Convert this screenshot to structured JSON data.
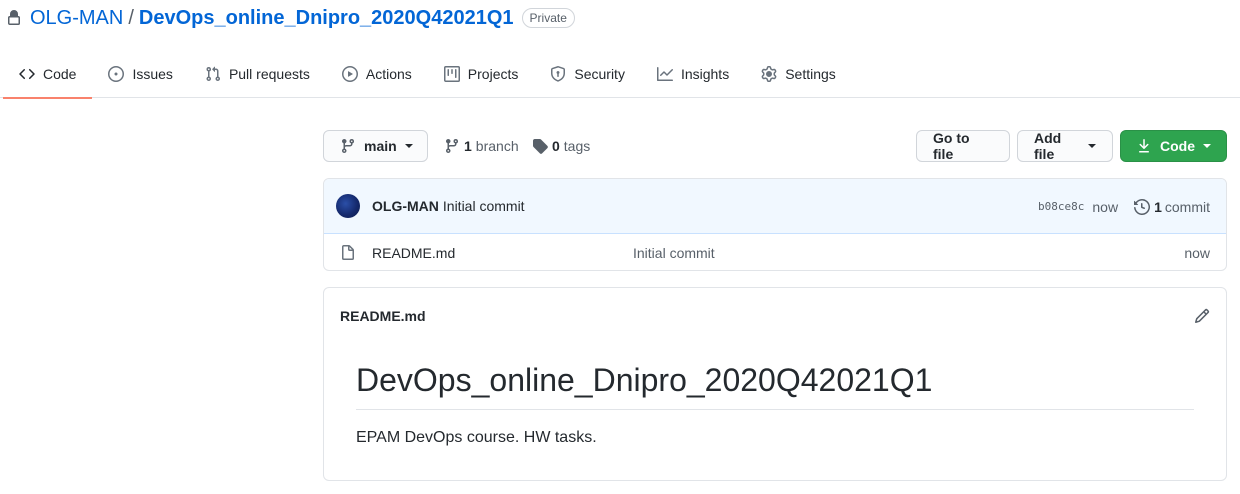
{
  "repo": {
    "owner": "OLG-MAN",
    "separator": "/",
    "name": "DevOps_online_Dnipro_2020Q42021Q1",
    "visibility": "Private"
  },
  "tabs": [
    {
      "label": "Code",
      "icon": "code-icon",
      "selected": true
    },
    {
      "label": "Issues",
      "icon": "issue-icon"
    },
    {
      "label": "Pull requests",
      "icon": "pull-request-icon"
    },
    {
      "label": "Actions",
      "icon": "play-icon"
    },
    {
      "label": "Projects",
      "icon": "project-icon"
    },
    {
      "label": "Security",
      "icon": "shield-icon"
    },
    {
      "label": "Insights",
      "icon": "graph-icon"
    },
    {
      "label": "Settings",
      "icon": "gear-icon"
    }
  ],
  "toolbar": {
    "branch": "main",
    "branch_count": "1",
    "branch_label": "branch",
    "tag_count": "0",
    "tag_label": "tags",
    "go_to_file": "Go to file",
    "add_file": "Add file",
    "code": "Code"
  },
  "latest_commit": {
    "author": "OLG-MAN",
    "message": "Initial commit",
    "sha": "b08ce8c",
    "age": "now",
    "commit_count": "1",
    "commit_label": "commit"
  },
  "files": [
    {
      "name": "README.md",
      "message": "Initial commit",
      "age": "now",
      "icon": "file-icon"
    }
  ],
  "readme": {
    "filename": "README.md",
    "heading": "DevOps_online_Dnipro_2020Q42021Q1",
    "paragraph": "EPAM DevOps course. HW tasks."
  },
  "colors": {
    "accent_link": "#0366d6",
    "tab_underline": "#f9826c",
    "code_button": "#2ea44f",
    "commit_bar": "#f1f8ff"
  }
}
